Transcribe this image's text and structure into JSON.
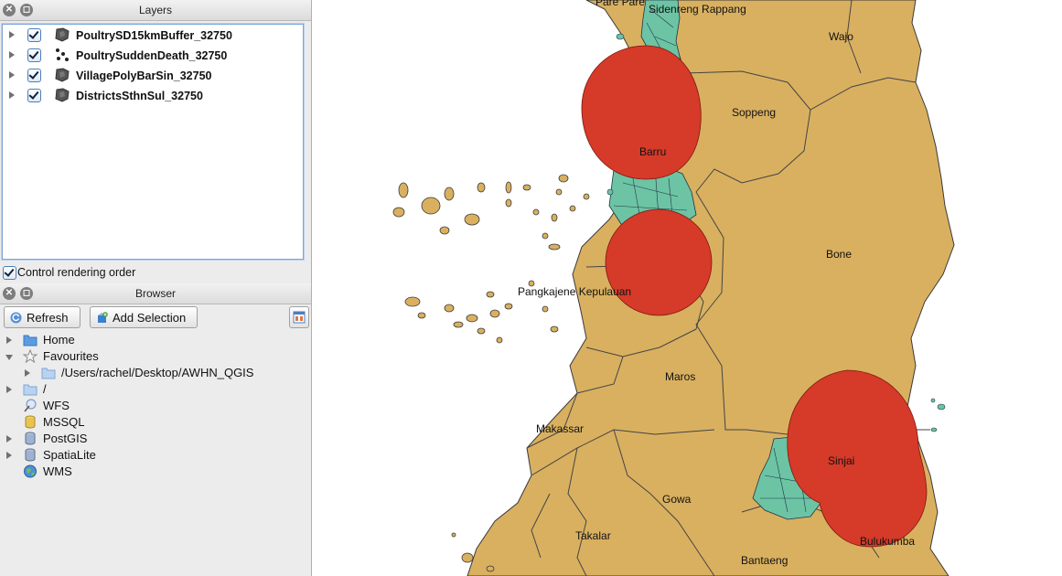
{
  "layers_panel": {
    "title": "Layers",
    "layers": [
      {
        "name": "PoultrySD15kmBuffer_32750",
        "checked": true,
        "icon": "polygon-layer-icon"
      },
      {
        "name": "PoultrySuddenDeath_32750",
        "checked": true,
        "icon": "point-layer-icon"
      },
      {
        "name": "VillagePolyBarSin_32750",
        "checked": true,
        "icon": "polygon-layer-icon"
      },
      {
        "name": "DistrictsSthnSul_32750",
        "checked": true,
        "icon": "polygon-layer-icon"
      }
    ],
    "control_rendering_order": "Control rendering order"
  },
  "browser_panel": {
    "title": "Browser",
    "refresh_label": "Refresh",
    "add_selection_label": "Add Selection",
    "items": [
      {
        "label": "Home",
        "icon": "folder-icon"
      },
      {
        "label": "Favourites",
        "icon": "star-icon"
      },
      {
        "label": "/Users/rachel/Desktop/AWHN_QGIS",
        "icon": "folder-icon"
      },
      {
        "label": "/",
        "icon": "folder-icon"
      },
      {
        "label": "WFS",
        "icon": "wfs-icon"
      },
      {
        "label": "MSSQL",
        "icon": "database-icon"
      },
      {
        "label": "PostGIS",
        "icon": "database-icon"
      },
      {
        "label": "SpatiaLite",
        "icon": "database-icon"
      },
      {
        "label": "WMS",
        "icon": "globe-icon"
      }
    ]
  },
  "map": {
    "colors": {
      "land": "#d9b060",
      "villages": "#6cc4a4",
      "buffer": "#d63a28",
      "sea": "#ffffff"
    },
    "labels": {
      "pare_pare": "Pare Pare",
      "sidenreng_rappang": "Sidenreng Rappang",
      "wajo": "Wajo",
      "soppeng": "Soppeng",
      "barru": "Barru",
      "bone": "Bone",
      "pangkajene_kepulauan": "Pangkajene Kepulauan",
      "maros": "Maros",
      "makassar": "Makassar",
      "sinjai": "Sinjai",
      "gowa": "Gowa",
      "takalar": "Takalar",
      "bulukumba": "Bulukumba",
      "bantaeng": "Bantaeng"
    }
  }
}
